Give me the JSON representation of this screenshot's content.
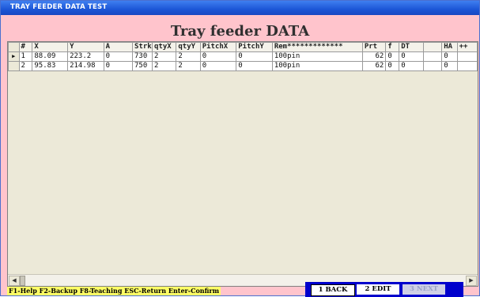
{
  "window": {
    "title": "TRAY FEEDER DATA TEST"
  },
  "heading": "Tray feeder DATA",
  "grid": {
    "current_row_marker": "▶",
    "columns": [
      "#",
      "X",
      "Y",
      "A",
      "Strk",
      "qtyX",
      "qtyY",
      "PitchX",
      "PitchY",
      "Rem*************",
      "Prt",
      "f",
      "DT",
      "",
      "HA",
      "++"
    ],
    "rows": [
      [
        "1",
        "88.09",
        "223.2",
        "0",
        "730",
        "2",
        "2",
        "0",
        "0",
        "100pin",
        "62",
        "0",
        "0",
        "",
        "0",
        ""
      ],
      [
        "2",
        "95.83",
        "214.98",
        "0",
        "750",
        "2",
        "2",
        "0",
        "0",
        "100pin",
        "62",
        "0",
        "0",
        "",
        "0",
        ""
      ]
    ]
  },
  "scrollbar": {
    "left_arrow": "◀",
    "right_arrow": "▶"
  },
  "help_text": "F1-Help F2-Backup F8-Teaching ESC-Return Enter-Confirm",
  "buttons": {
    "back": "1 BACK",
    "edit": "2 EDIT",
    "next": "3 NEXT"
  },
  "colors": {
    "window_bg": "#ffc4cc",
    "title_bar": "#1c56d6",
    "button_bar": "#0000cc",
    "help_bg": "#ffff66"
  }
}
